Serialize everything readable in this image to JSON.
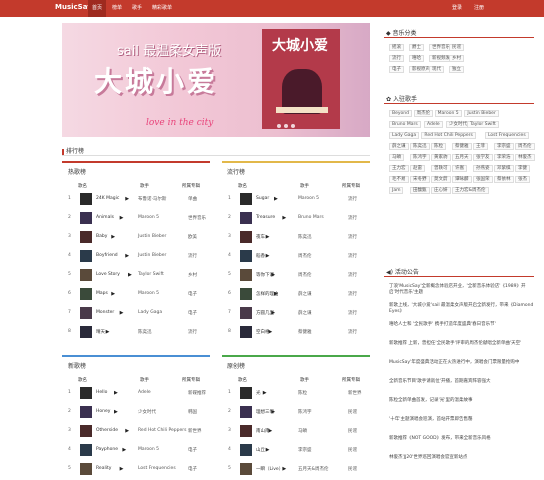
{
  "nav": {
    "logo": "MusicSay",
    "items": [
      "首页",
      "榜单",
      "歌手",
      "精彩歌单"
    ],
    "auth": [
      "登录",
      "注册"
    ]
  },
  "banner": {
    "subtitle": "sail 最温柔女声版",
    "title": "大城小爱",
    "script": "love in the city",
    "poster_title": "大城小爱"
  },
  "ranking": {
    "title": "排行榜",
    "headers": {
      "name": "歌名",
      "artist": "歌手",
      "album": "所属专辑"
    },
    "hot": {
      "title": "热歌榜",
      "rows": [
        {
          "num": "1",
          "song": "24K Magic",
          "artist": "布鲁诺·马尔斯",
          "album": "单曲"
        },
        {
          "num": "2",
          "song": "Animals",
          "artist": "Maroon 5",
          "album": "世界音乐"
        },
        {
          "num": "3",
          "song": "Baby",
          "artist": "Justin Bieber",
          "album": "欧美"
        },
        {
          "num": "4",
          "song": "Boyfriend",
          "artist": "Justin Bieber",
          "album": "流行"
        },
        {
          "num": "5",
          "song": "Love Story",
          "artist": "Taylor Swift",
          "album": "乡村"
        },
        {
          "num": "6",
          "song": "Maps",
          "artist": "Maroon 5",
          "album": "电子"
        },
        {
          "num": "7",
          "song": "Monster",
          "artist": "Lady Gaga",
          "album": "电子"
        },
        {
          "num": "8",
          "song": "晴天",
          "artist": "陈奕迅",
          "album": "流行"
        }
      ]
    },
    "pop": {
      "title": "流行榜",
      "rows": [
        {
          "num": "1",
          "song": "Sugar",
          "artist": "Maroon 5",
          "album": "流行"
        },
        {
          "num": "2",
          "song": "Treasure",
          "artist": "Bruno Mars",
          "album": "流行"
        },
        {
          "num": "3",
          "song": "夜车",
          "artist": "陈奕迅",
          "album": "流行"
        },
        {
          "num": "4",
          "song": "稻香",
          "artist": "周杰伦",
          "album": "流行"
        },
        {
          "num": "5",
          "song": "等你下课",
          "artist": "周杰伦",
          "album": "流行"
        },
        {
          "num": "6",
          "song": "怎样的理由",
          "artist": "薛之谦",
          "album": "流行"
        },
        {
          "num": "7",
          "song": "方圆几里",
          "artist": "薛之谦",
          "album": "流行"
        },
        {
          "num": "8",
          "song": "空白格",
          "artist": "蔡健雅",
          "album": "流行"
        }
      ]
    },
    "new": {
      "title": "新歌榜",
      "rows": [
        {
          "num": "1",
          "song": "Hello",
          "artist": "Adele",
          "album": "新碟推荐"
        },
        {
          "num": "2",
          "song": "Honey",
          "artist": "少女时代",
          "album": "韩国"
        },
        {
          "num": "3",
          "song": "Otherside",
          "artist": "Red Hot Chili Peppers",
          "album": "新世界"
        },
        {
          "num": "4",
          "song": "Payphone",
          "artist": "Maroon 5",
          "album": "电子"
        },
        {
          "num": "5",
          "song": "Reality",
          "artist": "Lost Frequencies",
          "album": "电子"
        }
      ]
    },
    "original": {
      "title": "原创榜",
      "rows": [
        {
          "num": "1",
          "song": "光",
          "artist": "陈粒",
          "album": "新世界"
        },
        {
          "num": "2",
          "song": "理想三旬",
          "artist": "陈鸿宇",
          "album": "民谣"
        },
        {
          "num": "3",
          "song": "南山南",
          "artist": "马頔",
          "album": "民谣"
        },
        {
          "num": "4",
          "song": "山丘",
          "artist": "李宗盛",
          "album": "民谣"
        },
        {
          "num": "5",
          "song": "一瞬（Live）",
          "artist": "五月天&周杰伦",
          "album": "民谣"
        }
      ]
    }
  },
  "sidebar": {
    "categories": {
      "title": "音乐分类",
      "tags": [
        "摇滚",
        "爵士",
        "世界音乐",
        "民谣",
        "流行",
        "嘻哈",
        "新视频发",
        "乡村",
        "电子",
        "影视原声",
        "现代",
        "独立"
      ]
    },
    "artists": {
      "title": "入驻歌手",
      "tags": [
        "Beyond",
        "周杰伦",
        "Maroon 5",
        "Justin Bieber",
        "Bruno Mars",
        "Adele",
        "少女时代",
        "Taylor Swift",
        "Lady Gaga",
        "Red Hot Chili Peppers",
        "Lost Frequencies",
        "薛之谦",
        "陈奕迅",
        "陈粒",
        "蔡健雅",
        "王菲",
        "李宗盛",
        "周杰伦",
        "马頔",
        "陈鸿宇",
        "黄家驹",
        "五月天",
        "张学友",
        "李荣浩",
        "林俊杰",
        "王力宏",
        "赵雷",
        "曾轶可",
        "许嵩",
        "孙燕姿",
        "邓紫棋",
        "李健",
        "毛不易",
        "宋冬野",
        "莫文蔚",
        "谭咏麟",
        "张国荣",
        "蔡依林",
        "张杰",
        "Jam",
        "田馥甄",
        "庄心妍",
        "王力宏&周杰伦"
      ]
    },
    "news": {
      "title": "活动公告",
      "items": [
        "丁浪'MusicSay'全新概念体验店开业，'全新音乐体验店'《1989》开启'时代音乐'主题",
        "新歌上线，'大城小爱'sail 最温柔女声版开启全新发行，带来《Diamond Eyes》",
        "嘻哈人士和 '全民歌手' 携手打造年度盛典'春日音乐节'",
        "新歌推荐 上新，曾担任'全民歌手'评审的周杰伦献唱全新单曲'天空'",
        "MusicSay'年度盛典活动正在火热进行中，演唱会门票限量抢购中",
        "全新音乐节目'歌手请就位'开播，首期嘉宾阵容强大",
        "陈粒全新单曲首发，记录'光'里的温柔故事",
        "'十年'主题演唱会巡演，首站开票即告售罄",
        "新歌推荐《NOT GOOD》发布，带来全新音乐风格",
        "林俊杰'JJ20'世界巡回演唱会官宣新站点"
      ]
    }
  }
}
